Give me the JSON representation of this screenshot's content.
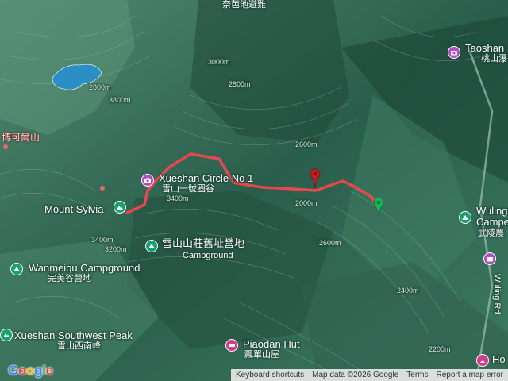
{
  "map": {
    "colors": {
      "terrain": "#2f6a55",
      "route": "#e8474f",
      "start_pin": "#18b35a",
      "end_pin": "#c51d23",
      "lake": "#2c8fc4"
    },
    "labels": {
      "xueshan_circle": "Xueshan Circle No 1",
      "xueshan_circle_zh": "雪山一號圈谷",
      "mount_sylvia": "Mount Sylvia",
      "campsite_zh": "雪山山莊舊址營地",
      "campground": "Campground",
      "wanmeiqu": "Wanmeiqu Campground",
      "wanmeiqu_zh": "完美谷營地",
      "southwest_peak": "Xueshan Southwest Peak",
      "southwest_peak_zh": "雪山西南峰",
      "piaodan_hut": "Piaodan Hut",
      "piaodan_hut_zh": "飄單山屋",
      "taoshan": "Taoshan",
      "taoshan_zh": "桃山瀑",
      "wuling": "Wuling",
      "wuling_campground": "Campe",
      "wuling_zh": "武陵農",
      "wuling_rd": "Wuling Rd",
      "hot_partial": "Ho",
      "bokeer": "博可爾山",
      "top_partial": "奈芭池避難"
    },
    "contours": {
      "c1": "2800m",
      "c2": "3800m",
      "c3": "2800m",
      "c4": "3400m",
      "c5": "2400m",
      "c6": "2600m",
      "c7": "2800m",
      "c8": "3000m",
      "c9": "3400m",
      "c10": "3200m",
      "c11": "2600m",
      "c12": "2400m",
      "c13": "2200m",
      "c14": "2000m"
    }
  },
  "footer": {
    "shortcuts": "Keyboard shortcuts",
    "map_data": "Map data ©2026 Google",
    "terms": "Terms",
    "report": "Report a map error"
  },
  "logo": {
    "text": "Google"
  }
}
